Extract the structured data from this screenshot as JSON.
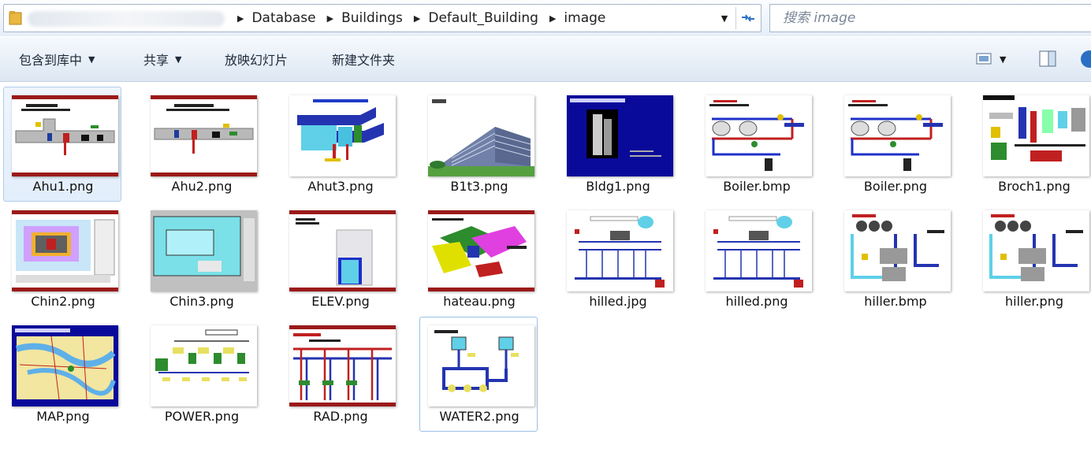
{
  "address_bar": {
    "breadcrumbs": [
      "Database",
      "Buildings",
      "Default_Building",
      "image"
    ],
    "search_placeholder": "搜索 image"
  },
  "toolbar": {
    "include_library": "包含到库中",
    "share": "共享",
    "slideshow": "放映幻灯片",
    "new_folder": "新建文件夹"
  },
  "files": [
    {
      "name": "Ahu1.png",
      "thumb": "ahu1"
    },
    {
      "name": "Ahu2.png",
      "thumb": "ahu2"
    },
    {
      "name": "Ahut3.png",
      "thumb": "ahut3"
    },
    {
      "name": "B1t3.png",
      "thumb": "building"
    },
    {
      "name": "Bldg1.png",
      "thumb": "bldg"
    },
    {
      "name": "Boiler.bmp",
      "thumb": "boiler"
    },
    {
      "name": "Boiler.png",
      "thumb": "boiler"
    },
    {
      "name": "Broch1.png",
      "thumb": "broch"
    },
    {
      "name": "Chin2.png",
      "thumb": "chin2"
    },
    {
      "name": "Chin3.png",
      "thumb": "chin3"
    },
    {
      "name": "ELEV.png",
      "thumb": "elev"
    },
    {
      "name": "hateau.png",
      "thumb": "hateau"
    },
    {
      "name": "hilled.jpg",
      "thumb": "chilled"
    },
    {
      "name": "hilled.png",
      "thumb": "chilled"
    },
    {
      "name": "hiller.bmp",
      "thumb": "chiller"
    },
    {
      "name": "hiller.png",
      "thumb": "chiller"
    },
    {
      "name": "MAP.png",
      "thumb": "map"
    },
    {
      "name": "POWER.png",
      "thumb": "power"
    },
    {
      "name": "RAD.png",
      "thumb": "rad"
    },
    {
      "name": "WATER2.png",
      "thumb": "water"
    }
  ],
  "selected_items": [
    "Ahu1.png"
  ],
  "focused_item": "WATER2.png"
}
